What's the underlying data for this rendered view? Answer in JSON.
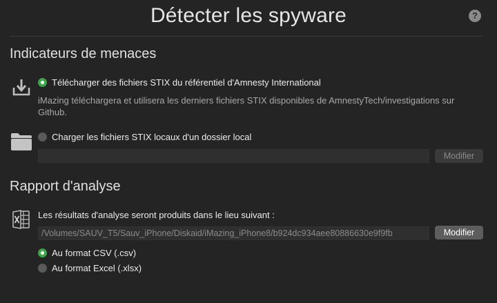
{
  "window": {
    "title": "Détecter les spyware",
    "help_label": "?"
  },
  "threats": {
    "heading": "Indicateurs de menaces",
    "download_option": {
      "label": "Télécharger des fichiers STIX du référentiel d'Amnesty International",
      "description": "iMazing téléchargera et utilisera les derniers fichiers STIX disponibles de AmnestyTech/investigations sur Github.",
      "selected": true,
      "icon": "download-icon"
    },
    "local_option": {
      "label": "Charger les fichiers STIX locaux d'un dossier local",
      "selected": false,
      "icon": "folder-icon",
      "path_value": "",
      "modify_label": "Modifier"
    }
  },
  "report": {
    "heading": "Rapport d'analyse",
    "location_label": "Les résultats d'analyse seront produits dans le lieu suivant :",
    "path_value": "/Volumes/SAUV_T5/Sauv_iPhone/Diskaid/iMazing_iPhone8/b924dc934aee80886630e9f9fb",
    "modify_label": "Modifier",
    "icon": "excel-icon",
    "formats": [
      {
        "label": "Au format CSV (.csv)",
        "selected": true
      },
      {
        "label": "Au format Excel (.xlsx)",
        "selected": false
      }
    ]
  },
  "colors": {
    "background": "#242424",
    "accent_green": "#3fa54a"
  }
}
